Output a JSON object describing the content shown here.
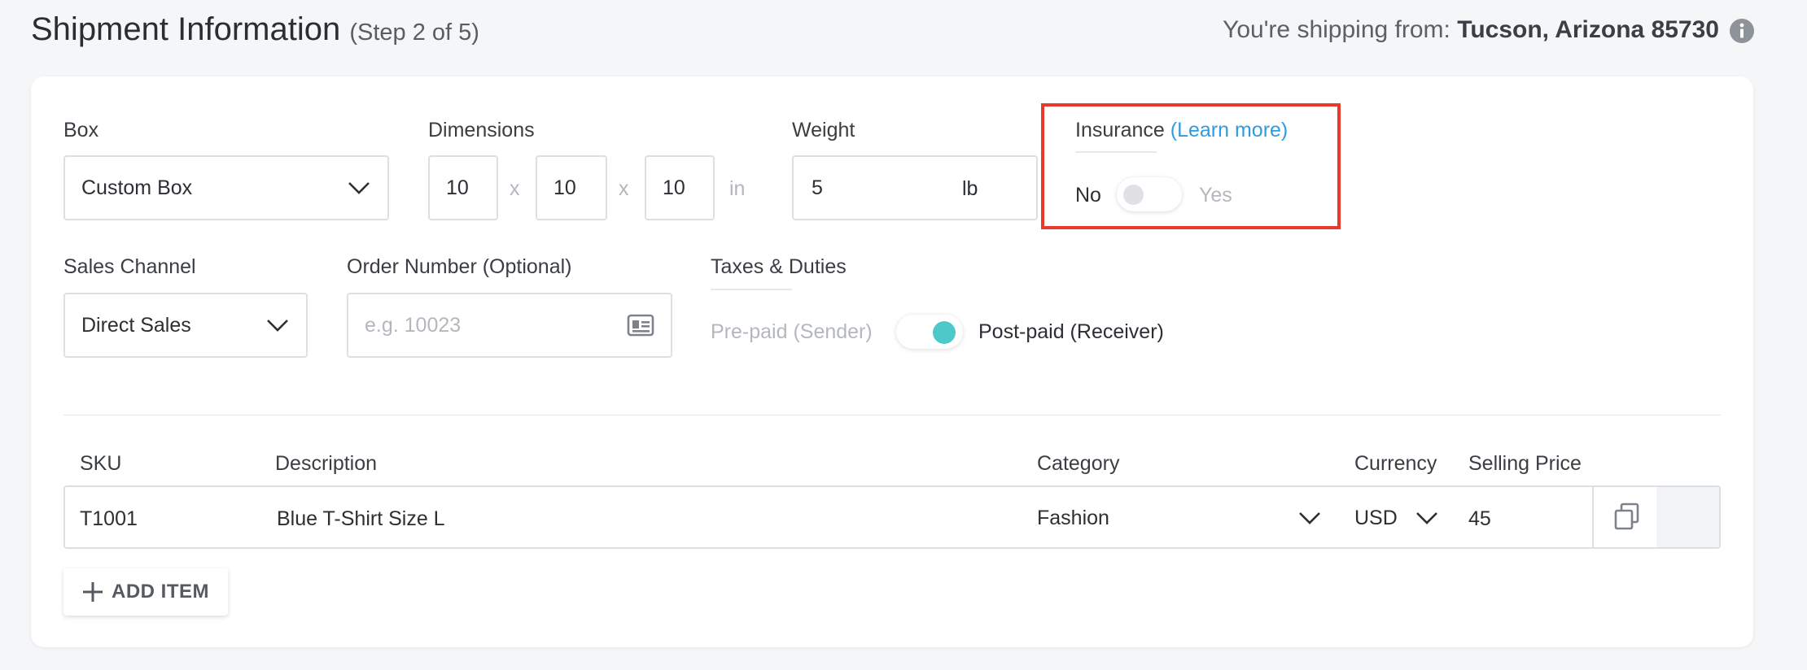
{
  "header": {
    "title": "Shipment Information",
    "step": "(Step 2 of 5)",
    "ship_from_prefix": "You're shipping from:",
    "ship_from_location": "Tucson, Arizona 85730"
  },
  "box": {
    "label": "Box",
    "value": "Custom Box"
  },
  "dimensions": {
    "label": "Dimensions",
    "length": "10",
    "width": "10",
    "height": "10",
    "separator": "x",
    "unit": "in"
  },
  "weight": {
    "label": "Weight",
    "value": "5",
    "unit": "lb"
  },
  "insurance": {
    "label": "Insurance",
    "learn_more": "(Learn more)",
    "off_label": "No",
    "on_label": "Yes",
    "enabled": false
  },
  "sales_channel": {
    "label": "Sales Channel",
    "value": "Direct Sales"
  },
  "order_number": {
    "label": "Order Number (Optional)",
    "placeholder": "e.g. 10023",
    "value": ""
  },
  "taxes": {
    "label": "Taxes & Duties",
    "prepaid_label": "Pre-paid (Sender)",
    "postpaid_label": "Post-paid (Receiver)",
    "selected": "postpaid"
  },
  "items_table": {
    "columns": {
      "sku": "SKU",
      "description": "Description",
      "category": "Category",
      "currency": "Currency",
      "price": "Selling Price"
    },
    "rows": [
      {
        "sku": "T1001",
        "description": "Blue T-Shirt Size L",
        "category": "Fashion",
        "currency": "USD",
        "price": "45"
      }
    ]
  },
  "add_item_label": "ADD ITEM",
  "colors": {
    "accent": "#4ec9c9",
    "link": "#2f9be0",
    "highlight": "#e8392b"
  }
}
